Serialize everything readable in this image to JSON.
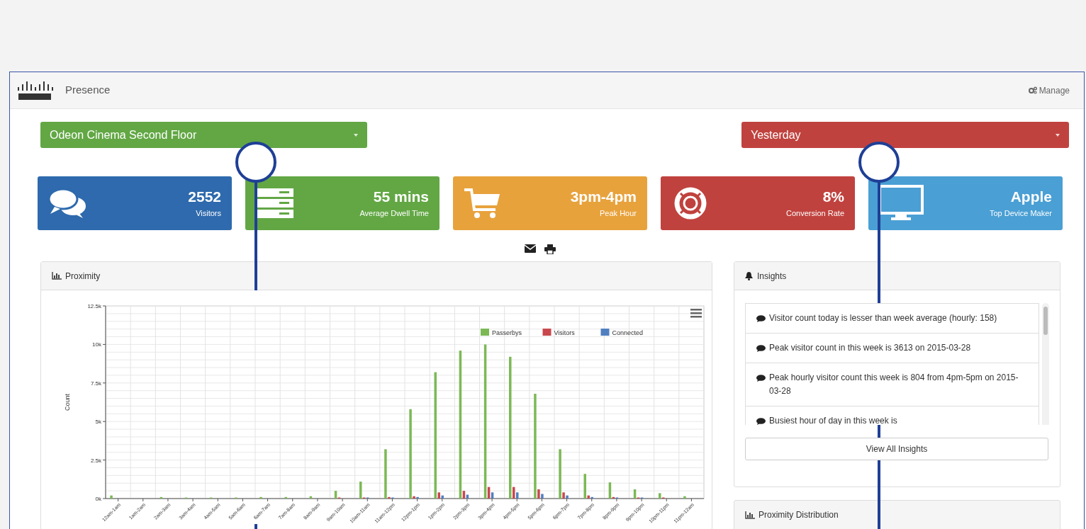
{
  "header": {
    "brand": "Presence",
    "manage": "Manage"
  },
  "filters": [
    {
      "kind": "location",
      "value": "Odeon Cinema Second Floor",
      "color": "#62a744"
    },
    {
      "kind": "period",
      "value": "Yesterday",
      "color": "#c0423e"
    }
  ],
  "stats": [
    {
      "value": "2552",
      "label": "Visitors",
      "color": "#2e6aad"
    },
    {
      "value": "55 mins",
      "label": "Average Dwell Time",
      "color": "#62a744"
    },
    {
      "value": "3pm-4pm",
      "label": "Peak Hour",
      "color": "#e8a23c"
    },
    {
      "value": "8%",
      "label": "Conversion Rate",
      "color": "#c0423e"
    },
    {
      "value": "Apple",
      "label": "Top Device Maker",
      "color": "#4a9fd4"
    }
  ],
  "proximity": {
    "title": "Proximity",
    "chart_data": {
      "type": "bar",
      "ylabel": "Count",
      "grid": true,
      "legend": true,
      "categories": [
        "12am-1am",
        "1am-2am",
        "2am-3am",
        "3am-4am",
        "4am-5am",
        "5am-6am",
        "6am-7am",
        "7am-8am",
        "8am-9am",
        "9am-10am",
        "10am-11am",
        "11am-12pm",
        "12pm-1pm",
        "1pm-2pm",
        "2pm-3pm",
        "3pm-4pm",
        "4pm-5pm",
        "5pm-6pm",
        "6pm-7pm",
        "7pm-8pm",
        "8pm-9pm",
        "9pm-10pm",
        "10pm-11pm",
        "11pm-12am"
      ],
      "series": [
        {
          "name": "Passerbys",
          "color": "#7cb956",
          "values": [
            200,
            0,
            100,
            50,
            50,
            50,
            100,
            100,
            150,
            500,
            1100,
            3200,
            5800,
            8200,
            9600,
            10000,
            9200,
            6800,
            3200,
            1600,
            1050,
            600,
            350,
            150
          ]
        },
        {
          "name": "Visitors",
          "color": "#c9484d",
          "values": [
            0,
            0,
            0,
            0,
            0,
            0,
            0,
            0,
            0,
            50,
            50,
            100,
            150,
            400,
            500,
            750,
            750,
            600,
            400,
            200,
            100,
            50,
            50,
            0
          ]
        },
        {
          "name": "Connected",
          "color": "#4f7fbf",
          "values": [
            0,
            0,
            0,
            0,
            0,
            0,
            0,
            0,
            0,
            0,
            50,
            50,
            100,
            200,
            250,
            400,
            400,
            300,
            200,
            100,
            50,
            50,
            0,
            0
          ]
        }
      ],
      "ylim": [
        0,
        12500
      ],
      "yticks": [
        {
          "value": 0,
          "label": "0k"
        },
        {
          "value": 2500,
          "label": "2.5k"
        },
        {
          "value": 5000,
          "label": "5k"
        },
        {
          "value": 7500,
          "label": "7.5k"
        },
        {
          "value": 10000,
          "label": "10k"
        },
        {
          "value": 12500,
          "label": "12.5k"
        }
      ]
    }
  },
  "insights": {
    "title": "Insights",
    "items": [
      "Visitor count today is lesser than week average (hourly: 158)",
      "Peak visitor count in this week is 3613 on 2015-03-28",
      "Peak hourly visitor count this week is 804 from 4pm-5pm on 2015-03-28",
      "Busiest hour of day in this week is"
    ],
    "button": "View All Insights"
  },
  "distribution": {
    "title": "Proximity Distribution"
  }
}
